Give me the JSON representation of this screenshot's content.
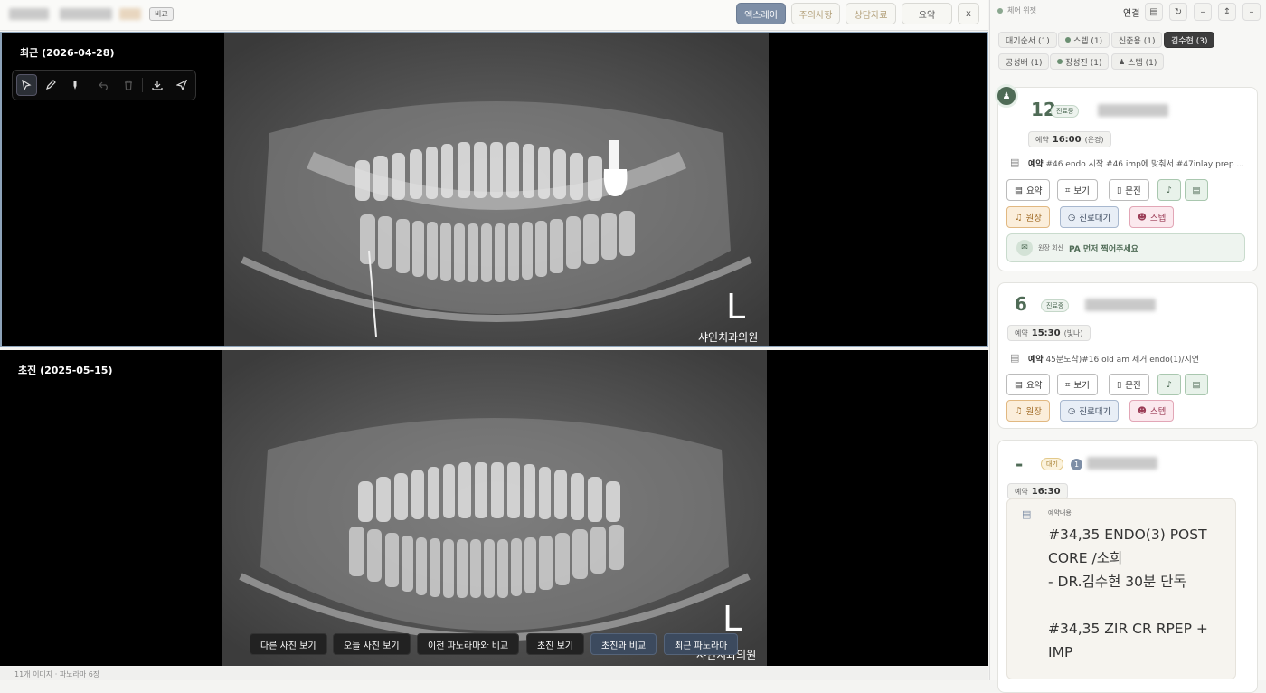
{
  "toolbar": {
    "compare_badge": "비교",
    "buttons": [
      {
        "label": "엑스레이",
        "active": true
      },
      {
        "label": "주의사항"
      },
      {
        "label": "상담자료"
      },
      {
        "label": "요약"
      },
      {
        "label": "x"
      }
    ]
  },
  "viewers": [
    {
      "label": "최근 (2026-04-28)",
      "clinic_watermark": "샤인치과의원",
      "side_marker": "L"
    },
    {
      "label": "초진 (2025-05-15)",
      "clinic_watermark": "샤인치과의원",
      "side_marker": "L"
    }
  ],
  "tools": [
    "pointer-icon",
    "pencil-icon",
    "marker-icon",
    "undo-icon",
    "trash-icon",
    "download-icon",
    "send-icon"
  ],
  "photo_buttons": [
    "다른 사진 보기",
    "오늘 사진 보기",
    "이전 파노라마와 비교",
    "초진 보기",
    "초진과 비교",
    "최근 파노라마"
  ],
  "status_bar": "11개 이미지 · 파노라마 6장",
  "panel": {
    "widget_title": "체어 위젯",
    "connect_label": "연결",
    "tabs_row1": [
      {
        "label": "대기순서 (1)"
      },
      {
        "label": "스텝 (1)",
        "dot": true
      },
      {
        "label": "신준용 (1)"
      },
      {
        "label": "김수현 (3)",
        "active": true
      }
    ],
    "tabs_row2": [
      {
        "label": "공성배 (1)"
      },
      {
        "label": "장성진 (1)",
        "dot": true
      },
      {
        "label": "스텝 (1)",
        "person": true
      }
    ],
    "cards": [
      {
        "number": "12",
        "status": "진료중",
        "resv_prefix": "예약",
        "resv_time": "16:00",
        "resv_tag": "(운경)",
        "note_prefix": "예약",
        "note": "#46 endo 시작 #46 imp에 맞춰서 #47inlay prep ...",
        "buttons": [
          "요약",
          "보기",
          "문진"
        ],
        "actions": [
          "원장",
          "진료대기",
          "스텝"
        ],
        "reply_label": "원장 회신",
        "reply_text": "PA 먼저 찍어주세요"
      },
      {
        "number": "6",
        "status": "진료중",
        "resv_prefix": "예약",
        "resv_time": "15:30",
        "resv_tag": "(빛나)",
        "note_prefix": "예약",
        "note": "45분도착)#16 old am 제거 endo(1)/지연",
        "buttons": [
          "요약",
          "보기",
          "문진"
        ],
        "actions": [
          "원장",
          "진료대기",
          "스텝"
        ]
      },
      {
        "number": "-",
        "status": "대기",
        "visit_count": "1",
        "resv_prefix": "예약",
        "resv_time": "16:30",
        "memo_label": "예약내용",
        "memo_text": "#34,35 ENDO(3) POST CORE /소희\n- DR.김수현 30분 단독\n\n#34,35 ZIR CR RPEP + IMP"
      }
    ]
  }
}
